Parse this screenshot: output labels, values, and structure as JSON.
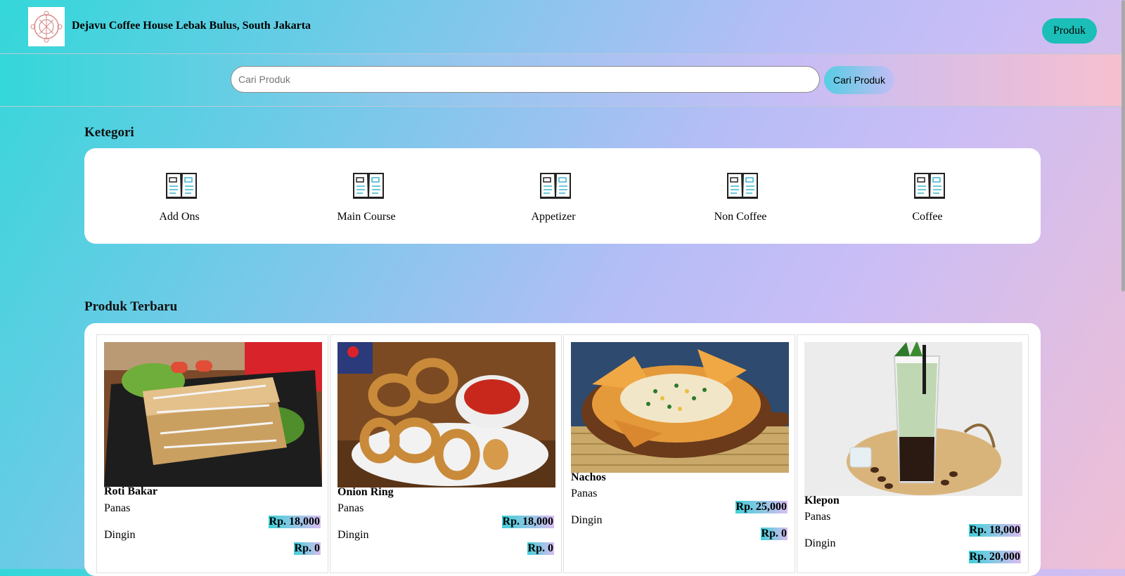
{
  "header": {
    "title": "Dejavu Coffee House Lebak Bulus, South Jakarta",
    "nav_button": "Produk",
    "logo_icon": "logo-icon"
  },
  "search": {
    "placeholder": "Cari Produk",
    "button_label": "Cari Produk"
  },
  "categories": {
    "title": "Ketegori",
    "items": [
      {
        "label": "Add Ons",
        "icon": "menu-book-icon"
      },
      {
        "label": "Main Course",
        "icon": "menu-book-icon"
      },
      {
        "label": "Appetizer",
        "icon": "menu-book-icon"
      },
      {
        "label": "Non Coffee",
        "icon": "menu-book-icon"
      },
      {
        "label": "Coffee",
        "icon": "menu-book-icon"
      }
    ]
  },
  "products": {
    "title": "Produk Terbaru",
    "items": [
      {
        "name": "Roti Bakar",
        "hot_label": "Panas",
        "hot_price": "Rp. 18,000",
        "cold_label": "Dingin",
        "cold_price": "Rp. 0"
      },
      {
        "name": "Onion Ring",
        "hot_label": "Panas",
        "hot_price": "Rp. 18,000",
        "cold_label": "Dingin",
        "cold_price": "Rp. 0"
      },
      {
        "name": "Nachos",
        "hot_label": "Panas",
        "hot_price": "Rp. 25,000",
        "cold_label": "Dingin",
        "cold_price": "Rp. 0"
      },
      {
        "name": "Klepon",
        "hot_label": "Panas",
        "hot_price": "Rp. 18,000",
        "cold_label": "Dingin",
        "cold_price": "Rp. 20,000"
      }
    ]
  },
  "colors": {
    "accent": "#1bbfb8",
    "gradient_start": "#33d7d9",
    "gradient_end": "#f0bfd4"
  }
}
